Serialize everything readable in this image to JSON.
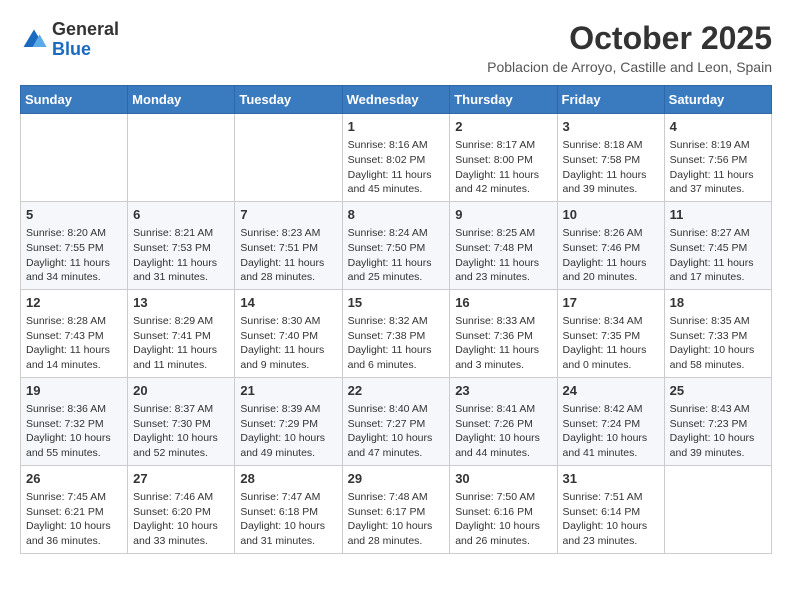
{
  "logo": {
    "general": "General",
    "blue": "Blue"
  },
  "header": {
    "title": "October 2025",
    "subtitle": "Poblacion de Arroyo, Castille and Leon, Spain"
  },
  "weekdays": [
    "Sunday",
    "Monday",
    "Tuesday",
    "Wednesday",
    "Thursday",
    "Friday",
    "Saturday"
  ],
  "weeks": [
    [
      {
        "day": "",
        "info": ""
      },
      {
        "day": "",
        "info": ""
      },
      {
        "day": "",
        "info": ""
      },
      {
        "day": "1",
        "info": "Sunrise: 8:16 AM\nSunset: 8:02 PM\nDaylight: 11 hours and 45 minutes."
      },
      {
        "day": "2",
        "info": "Sunrise: 8:17 AM\nSunset: 8:00 PM\nDaylight: 11 hours and 42 minutes."
      },
      {
        "day": "3",
        "info": "Sunrise: 8:18 AM\nSunset: 7:58 PM\nDaylight: 11 hours and 39 minutes."
      },
      {
        "day": "4",
        "info": "Sunrise: 8:19 AM\nSunset: 7:56 PM\nDaylight: 11 hours and 37 minutes."
      }
    ],
    [
      {
        "day": "5",
        "info": "Sunrise: 8:20 AM\nSunset: 7:55 PM\nDaylight: 11 hours and 34 minutes."
      },
      {
        "day": "6",
        "info": "Sunrise: 8:21 AM\nSunset: 7:53 PM\nDaylight: 11 hours and 31 minutes."
      },
      {
        "day": "7",
        "info": "Sunrise: 8:23 AM\nSunset: 7:51 PM\nDaylight: 11 hours and 28 minutes."
      },
      {
        "day": "8",
        "info": "Sunrise: 8:24 AM\nSunset: 7:50 PM\nDaylight: 11 hours and 25 minutes."
      },
      {
        "day": "9",
        "info": "Sunrise: 8:25 AM\nSunset: 7:48 PM\nDaylight: 11 hours and 23 minutes."
      },
      {
        "day": "10",
        "info": "Sunrise: 8:26 AM\nSunset: 7:46 PM\nDaylight: 11 hours and 20 minutes."
      },
      {
        "day": "11",
        "info": "Sunrise: 8:27 AM\nSunset: 7:45 PM\nDaylight: 11 hours and 17 minutes."
      }
    ],
    [
      {
        "day": "12",
        "info": "Sunrise: 8:28 AM\nSunset: 7:43 PM\nDaylight: 11 hours and 14 minutes."
      },
      {
        "day": "13",
        "info": "Sunrise: 8:29 AM\nSunset: 7:41 PM\nDaylight: 11 hours and 11 minutes."
      },
      {
        "day": "14",
        "info": "Sunrise: 8:30 AM\nSunset: 7:40 PM\nDaylight: 11 hours and 9 minutes."
      },
      {
        "day": "15",
        "info": "Sunrise: 8:32 AM\nSunset: 7:38 PM\nDaylight: 11 hours and 6 minutes."
      },
      {
        "day": "16",
        "info": "Sunrise: 8:33 AM\nSunset: 7:36 PM\nDaylight: 11 hours and 3 minutes."
      },
      {
        "day": "17",
        "info": "Sunrise: 8:34 AM\nSunset: 7:35 PM\nDaylight: 11 hours and 0 minutes."
      },
      {
        "day": "18",
        "info": "Sunrise: 8:35 AM\nSunset: 7:33 PM\nDaylight: 10 hours and 58 minutes."
      }
    ],
    [
      {
        "day": "19",
        "info": "Sunrise: 8:36 AM\nSunset: 7:32 PM\nDaylight: 10 hours and 55 minutes."
      },
      {
        "day": "20",
        "info": "Sunrise: 8:37 AM\nSunset: 7:30 PM\nDaylight: 10 hours and 52 minutes."
      },
      {
        "day": "21",
        "info": "Sunrise: 8:39 AM\nSunset: 7:29 PM\nDaylight: 10 hours and 49 minutes."
      },
      {
        "day": "22",
        "info": "Sunrise: 8:40 AM\nSunset: 7:27 PM\nDaylight: 10 hours and 47 minutes."
      },
      {
        "day": "23",
        "info": "Sunrise: 8:41 AM\nSunset: 7:26 PM\nDaylight: 10 hours and 44 minutes."
      },
      {
        "day": "24",
        "info": "Sunrise: 8:42 AM\nSunset: 7:24 PM\nDaylight: 10 hours and 41 minutes."
      },
      {
        "day": "25",
        "info": "Sunrise: 8:43 AM\nSunset: 7:23 PM\nDaylight: 10 hours and 39 minutes."
      }
    ],
    [
      {
        "day": "26",
        "info": "Sunrise: 7:45 AM\nSunset: 6:21 PM\nDaylight: 10 hours and 36 minutes."
      },
      {
        "day": "27",
        "info": "Sunrise: 7:46 AM\nSunset: 6:20 PM\nDaylight: 10 hours and 33 minutes."
      },
      {
        "day": "28",
        "info": "Sunrise: 7:47 AM\nSunset: 6:18 PM\nDaylight: 10 hours and 31 minutes."
      },
      {
        "day": "29",
        "info": "Sunrise: 7:48 AM\nSunset: 6:17 PM\nDaylight: 10 hours and 28 minutes."
      },
      {
        "day": "30",
        "info": "Sunrise: 7:50 AM\nSunset: 6:16 PM\nDaylight: 10 hours and 26 minutes."
      },
      {
        "day": "31",
        "info": "Sunrise: 7:51 AM\nSunset: 6:14 PM\nDaylight: 10 hours and 23 minutes."
      },
      {
        "day": "",
        "info": ""
      }
    ]
  ]
}
